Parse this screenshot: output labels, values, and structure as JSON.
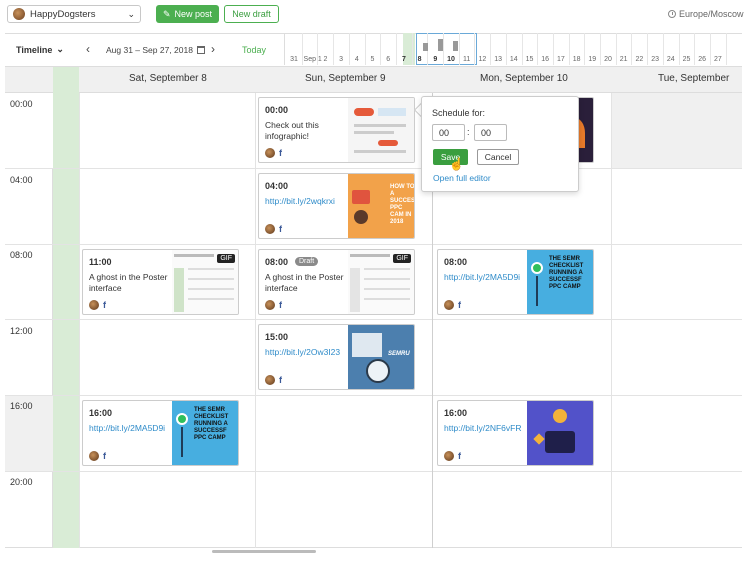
{
  "header": {
    "project_name": "HappyDogsters",
    "new_post_label": "New post",
    "new_draft_label": "New draft",
    "timezone": "Europe/Moscow"
  },
  "toolbar": {
    "view_label": "Timeline",
    "date_range": "Aug 31 – Sep 27, 2018",
    "today_label": "Today"
  },
  "mini_timeline": {
    "days": [
      "31",
      "Sep 1",
      "2",
      "3",
      "4",
      "5",
      "6",
      "7",
      "8",
      "9",
      "10",
      "11",
      "12",
      "13",
      "14",
      "15",
      "16",
      "17",
      "18",
      "19",
      "20",
      "21",
      "22",
      "23",
      "24",
      "25",
      "26",
      "27"
    ],
    "today": "7",
    "selected": [
      "8",
      "9",
      "10"
    ]
  },
  "columns": [
    {
      "label": "Sat, September 8"
    },
    {
      "label": "Sun, September 9"
    },
    {
      "label": "Mon, September 10"
    },
    {
      "label": "Tue, September"
    }
  ],
  "time_slots": [
    "00:00",
    "04:00",
    "08:00",
    "12:00",
    "16:00",
    "20:00"
  ],
  "posts": [
    {
      "time": "00:00",
      "text": "Check out this infographic!",
      "network": "f"
    },
    {
      "time": "04:00",
      "link": "http://bit.ly/2wqkrxi",
      "network": "f",
      "thumb_text": "HOW TO A SUCCESS PPC CAM IN 2018"
    },
    {
      "time": "11:00",
      "text": "A ghost in the Poster interface",
      "network": "f",
      "gif": "GIF"
    },
    {
      "time": "08:00",
      "draft": "Draft",
      "text": "A ghost in the Poster interface",
      "network": "f",
      "gif": "GIF"
    },
    {
      "time": "08:00",
      "link": "http://bit.ly/2MA5D9i",
      "network": "f",
      "thumb_text": "THE SEMR CHECKLIST RUNNING A SUCCESSF PPC CAMP"
    },
    {
      "time": "15:00",
      "link": "http://bit.ly/2Ow3I23",
      "network": "f",
      "thumb_text": "SEMRU"
    },
    {
      "time": "16:00",
      "link": "http://bit.ly/2MA5D9i",
      "network": "f",
      "thumb_text": "THE SEMR CHECKLIST RUNNING A SUCCESSF PPC CAMP"
    },
    {
      "time": "16:00",
      "link": "http://bit.ly/2NF6vFR",
      "network": "f"
    }
  ],
  "popover": {
    "title": "Schedule for:",
    "hours": "00",
    "minutes": "00",
    "separator": ":",
    "save_label": "Save",
    "cancel_label": "Cancel",
    "link_label": "Open full editor"
  },
  "colors": {
    "accent": "#4caf50",
    "link": "#2e8bc9",
    "today_bg": "#d9ecd6",
    "facebook": "#3b5998"
  }
}
